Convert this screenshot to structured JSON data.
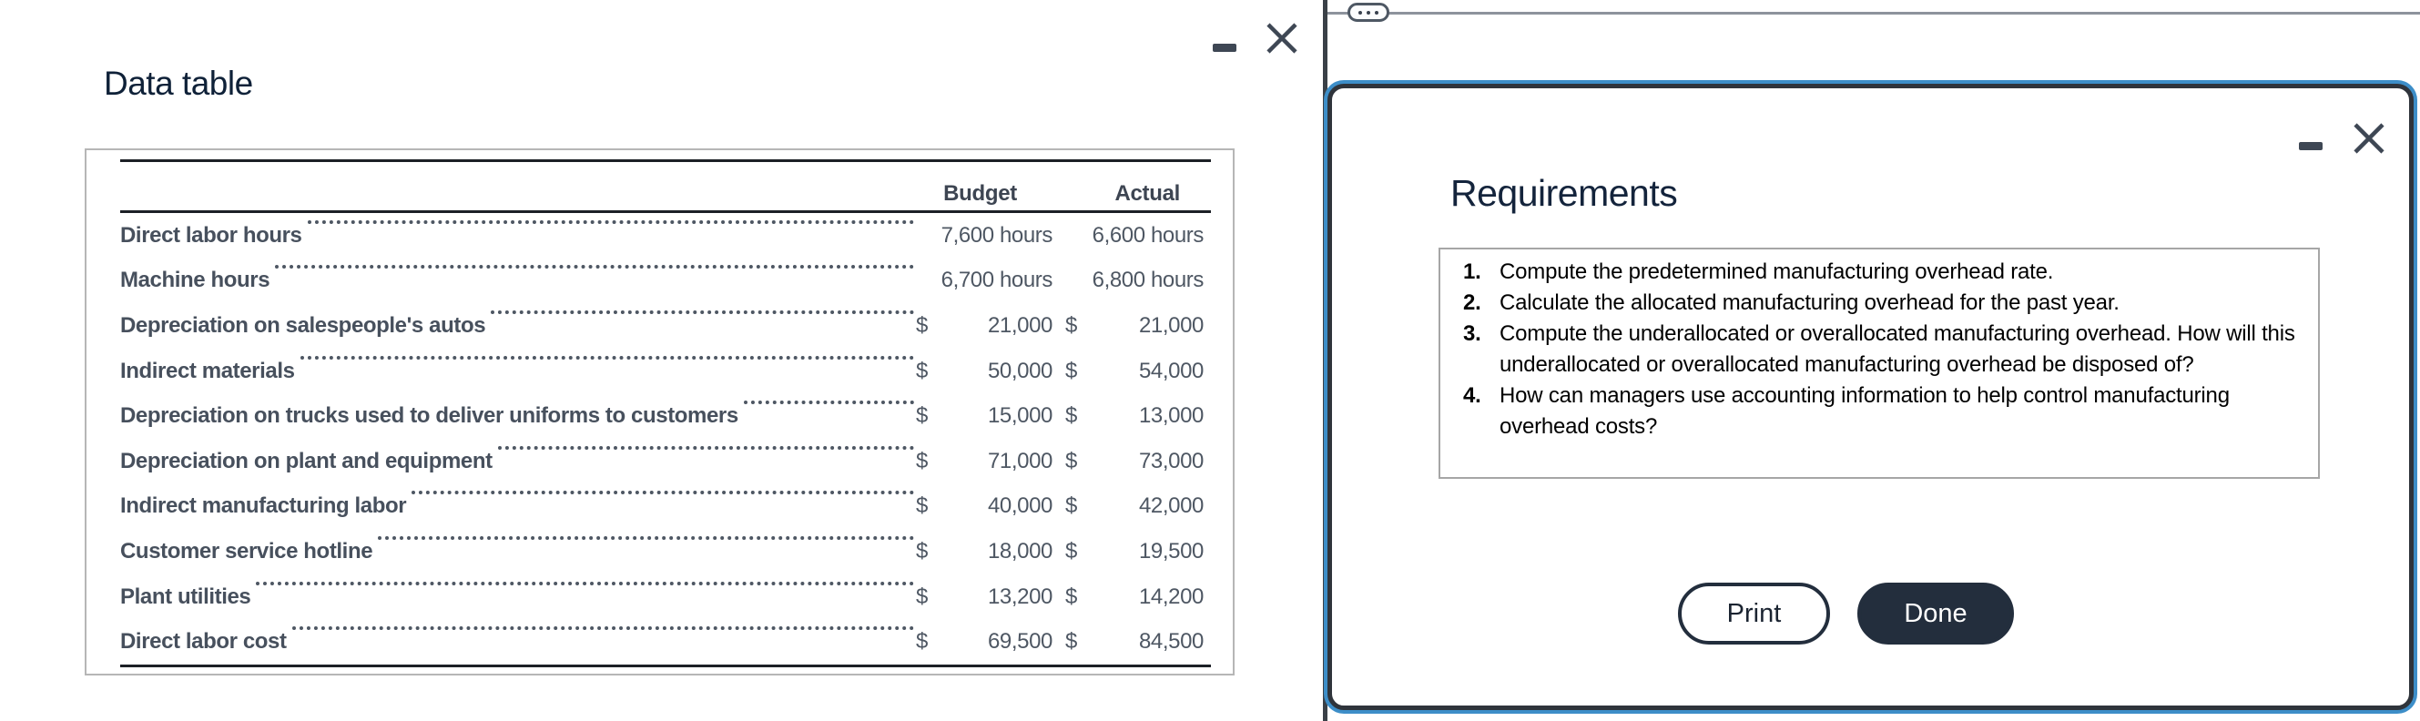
{
  "left_window": {
    "title": "Data table",
    "controls": {
      "minimize": "minimize",
      "close": "close"
    },
    "table": {
      "col_headers": [
        "Budget",
        "Actual"
      ],
      "rows": [
        {
          "label": "Direct labor hours",
          "currency": "",
          "budget": "7,600 hours",
          "actual": "6,600 hours"
        },
        {
          "label": "Machine hours",
          "currency": "",
          "budget": "6,700 hours",
          "actual": "6,800 hours"
        },
        {
          "label": "Depreciation on salespeople's autos",
          "currency": "$",
          "budget": "21,000",
          "actual": "21,000"
        },
        {
          "label": "Indirect materials",
          "currency": "$",
          "budget": "50,000",
          "actual": "54,000"
        },
        {
          "label": "Depreciation on trucks used to deliver uniforms to customers",
          "currency": "$",
          "budget": "15,000",
          "actual": "13,000"
        },
        {
          "label": "Depreciation on plant and equipment",
          "currency": "$",
          "budget": "71,000",
          "actual": "73,000"
        },
        {
          "label": "Indirect manufacturing labor",
          "currency": "$",
          "budget": "40,000",
          "actual": "42,000"
        },
        {
          "label": "Customer service hotline",
          "currency": "$",
          "budget": "18,000",
          "actual": "19,500"
        },
        {
          "label": "Plant utilities",
          "currency": "$",
          "budget": "13,200",
          "actual": "14,200"
        },
        {
          "label": "Direct labor cost",
          "currency": "$",
          "budget": "69,500",
          "actual": "84,500"
        }
      ]
    }
  },
  "background_window": {
    "overflow_handle": "..."
  },
  "dialog": {
    "title": "Requirements",
    "controls": {
      "minimize": "minimize",
      "close": "close"
    },
    "requirements": [
      {
        "num": "1.",
        "text": "Compute the predetermined manufacturing overhead rate."
      },
      {
        "num": "2.",
        "text": "Calculate the allocated manufacturing overhead for the past year."
      },
      {
        "num": "3.",
        "text": "Compute the underallocated or overallocated manufacturing overhead. How will this underallocated or overallocated manufacturing overhead be disposed of?"
      },
      {
        "num": "4.",
        "text": "How can managers use accounting information to help control manufacturing overhead costs?"
      }
    ],
    "buttons": {
      "print": "Print",
      "done": "Done"
    }
  },
  "colors": {
    "accent_blue": "#3d8ec8",
    "dark_border": "#2f343b",
    "button_dark": "#232e3d",
    "table_text": "#4e5763",
    "title_navy": "#0f2138",
    "rule_black": "#1c2026",
    "box_border_gray": "#b6b6b6"
  }
}
